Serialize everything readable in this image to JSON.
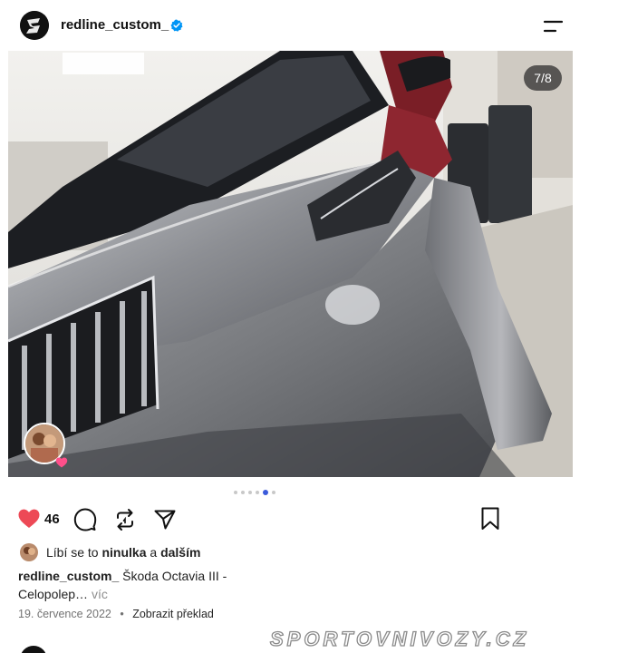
{
  "post": {
    "author": {
      "username": "redline_custom_",
      "verified": true
    },
    "carousel": {
      "counter": "7/8",
      "current_index": 7,
      "total": 8,
      "visible_dots": 6,
      "active_dot": 5
    },
    "likes": {
      "count": "46",
      "liked_by_prefix": "Líbí se to",
      "liked_by_user": "ninulka",
      "liked_by_connector": "a",
      "liked_by_suffix": "dalším"
    },
    "caption": {
      "username": "redline_custom_",
      "text": "Škoda Octavia III -Celopolep…",
      "more": "víc"
    },
    "meta": {
      "date": "19. července 2022",
      "separator": "•",
      "translate": "Zobrazit překlad"
    }
  },
  "watermark": "SPORTOVNIVOZY.CZ",
  "colors": {
    "like_red": "#ed4956",
    "verified_blue": "#0095f6",
    "active_dot": "#3b5bdb"
  },
  "icons": {
    "menu": "menu-icon",
    "like": "heart-icon",
    "comment": "comment-icon",
    "repost": "repost-icon",
    "share": "send-icon",
    "save": "bookmark-icon"
  }
}
